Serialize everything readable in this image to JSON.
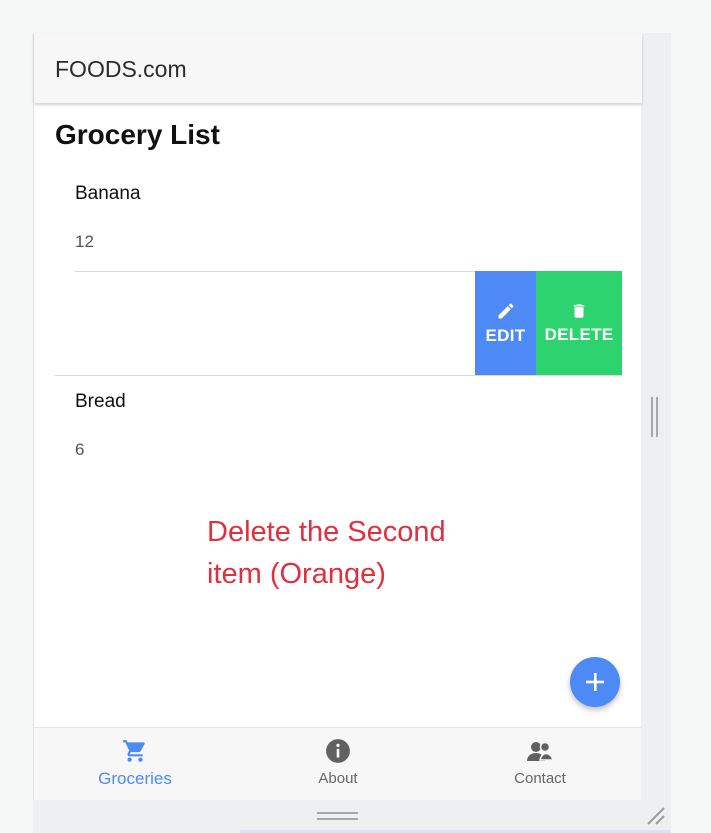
{
  "header": {
    "title": "FOODS.com"
  },
  "page": {
    "title": "Grocery List"
  },
  "items": [
    {
      "name": "Banana",
      "quantity": "12"
    },
    {
      "name": "Bread",
      "quantity": "6"
    }
  ],
  "swipe_actions": {
    "edit_label": "EDIT",
    "delete_label": "DELETE"
  },
  "annotation": {
    "text": "Delete the Second item (Orange)"
  },
  "tabs": [
    {
      "label": "Groceries",
      "icon": "cart-icon",
      "active": true
    },
    {
      "label": "About",
      "icon": "info-icon",
      "active": false
    },
    {
      "label": "Contact",
      "icon": "people-icon",
      "active": false
    }
  ],
  "colors": {
    "accent": "#4d8af6",
    "delete": "#2dd36f",
    "annotation": "#e0303d"
  }
}
